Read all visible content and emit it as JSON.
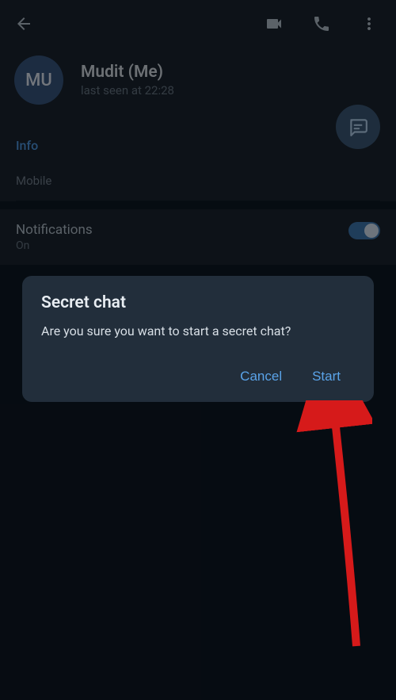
{
  "profile": {
    "avatar_initials": "MU",
    "name": "Mudit (Me)",
    "status": "last seen at 22:28"
  },
  "info": {
    "section_title": "Info",
    "mobile_label": "Mobile"
  },
  "notifications": {
    "title": "Notifications",
    "status": "On",
    "toggle_on": true
  },
  "dialog": {
    "title": "Secret chat",
    "message": "Are you sure you want to start a secret chat?",
    "cancel_label": "Cancel",
    "confirm_label": "Start"
  }
}
